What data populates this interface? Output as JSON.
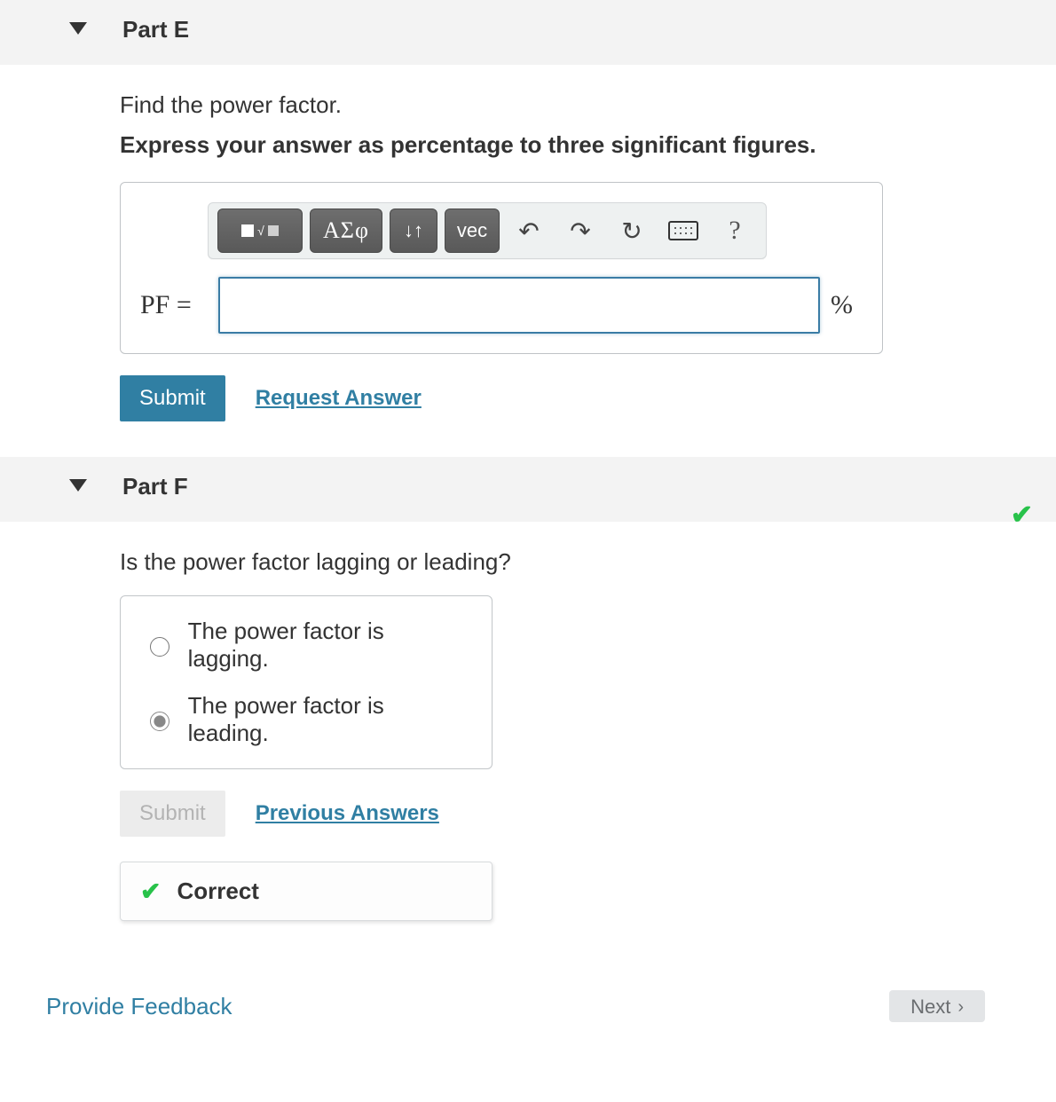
{
  "partE": {
    "title": "Part E",
    "prompt": "Find the power factor.",
    "instruction": "Express your answer as percentage to three significant figures.",
    "toolbar": {
      "greek": "ΑΣφ",
      "vec": "vec",
      "help": "?"
    },
    "variable_label": "PF =",
    "input_value": "",
    "unit": "%",
    "submit": "Submit",
    "request_answer": "Request Answer"
  },
  "partF": {
    "title": "Part F",
    "prompt": "Is the power factor lagging or leading?",
    "options": [
      {
        "label": "The power factor is lagging.",
        "selected": false
      },
      {
        "label": "The power factor is leading.",
        "selected": true
      }
    ],
    "submit": "Submit",
    "previous_answers": "Previous Answers",
    "feedback_label": "Correct"
  },
  "footer": {
    "provide_feedback": "Provide Feedback",
    "next": "Next"
  }
}
